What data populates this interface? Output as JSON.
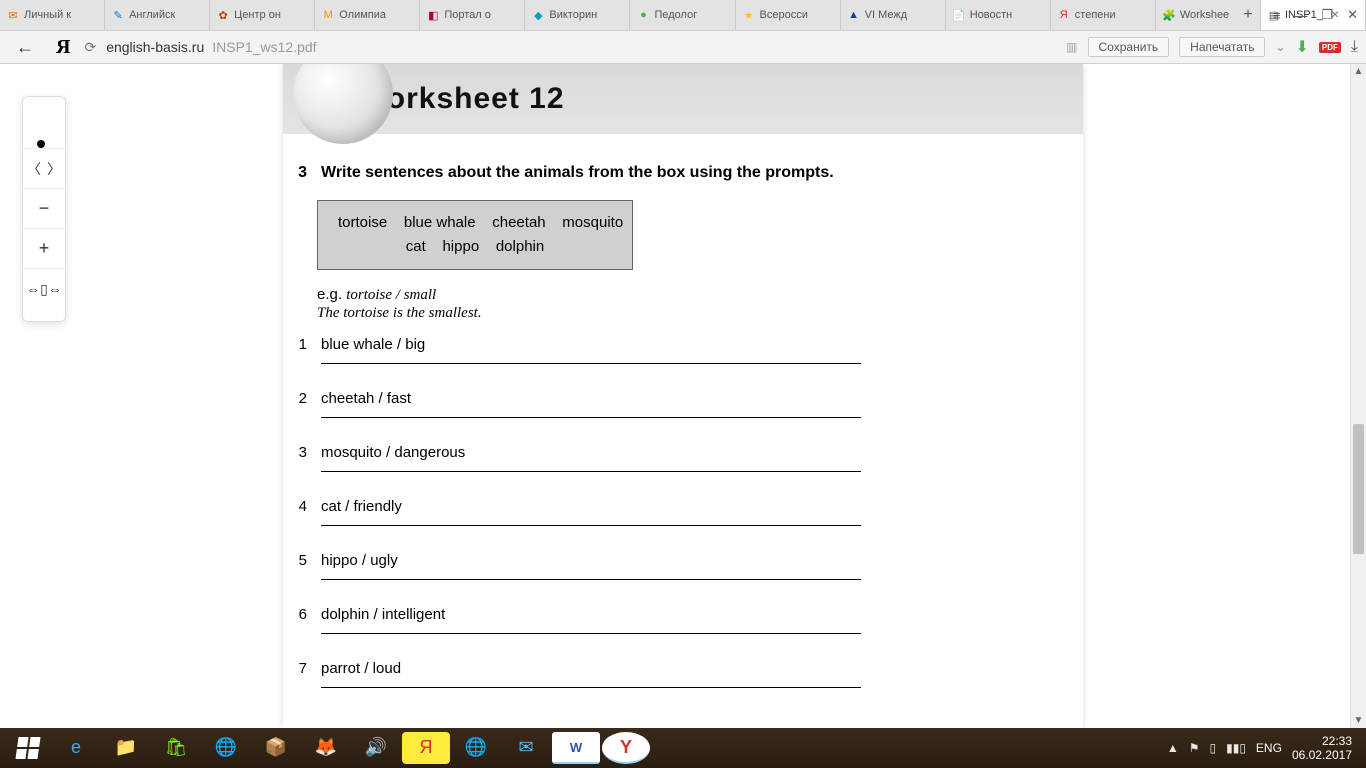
{
  "browser": {
    "tabs": [
      {
        "icon": "✉",
        "color": "#ff6a00",
        "label": "Личный к"
      },
      {
        "icon": "✎",
        "color": "#0072c6",
        "label": "Английск"
      },
      {
        "icon": "✿",
        "color": "#c04000",
        "label": "Центр он"
      },
      {
        "icon": "М",
        "color": "#ff8c00",
        "label": "Олимпиа"
      },
      {
        "icon": "◧",
        "color": "#b00020",
        "label": "Портал о"
      },
      {
        "icon": "◆",
        "color": "#00a0c6",
        "label": "Викторин"
      },
      {
        "icon": "●",
        "color": "#4caf50",
        "label": "Педолог"
      },
      {
        "icon": "★",
        "color": "#f4c430",
        "label": "Всеросси"
      },
      {
        "icon": "▲",
        "color": "#0d47a1",
        "label": "VI Межд"
      },
      {
        "icon": "📄",
        "color": "#888",
        "label": "Новостн"
      },
      {
        "icon": "Я",
        "color": "#d32f2f",
        "label": "степени"
      },
      {
        "icon": "🧩",
        "color": "#888",
        "label": "Workshee"
      },
      {
        "icon": "▤",
        "color": "#555",
        "label": "INSP1_",
        "active": true
      }
    ],
    "url_host": "english-basis.ru",
    "url_path": "INSP1_ws12.pdf",
    "save_label": "Сохранить",
    "print_label": "Напечатать"
  },
  "document": {
    "title": "Worksheet 12",
    "exercise_number": "3",
    "instruction": "Write sentences about the animals from the box using the prompts.",
    "wordbox_row1": "tortoise    blue whale    cheetah    mosquito",
    "wordbox_row2": "cat    hippo    dolphin",
    "example_lead": "e.g.",
    "example_prompt": "tortoise / small",
    "example_answer": "The tortoise is the smallest.",
    "questions": [
      {
        "n": "1",
        "prompt": "blue whale / big"
      },
      {
        "n": "2",
        "prompt": "cheetah / fast"
      },
      {
        "n": "3",
        "prompt": "mosquito / dangerous"
      },
      {
        "n": "4",
        "prompt": "cat / friendly"
      },
      {
        "n": "5",
        "prompt": "hippo / ugly"
      },
      {
        "n": "6",
        "prompt": "dolphin / intelligent"
      },
      {
        "n": "7",
        "prompt": "parrot / loud"
      }
    ]
  },
  "taskbar": {
    "lang": "ENG",
    "time": "22:33",
    "date": "06.02.2017"
  }
}
